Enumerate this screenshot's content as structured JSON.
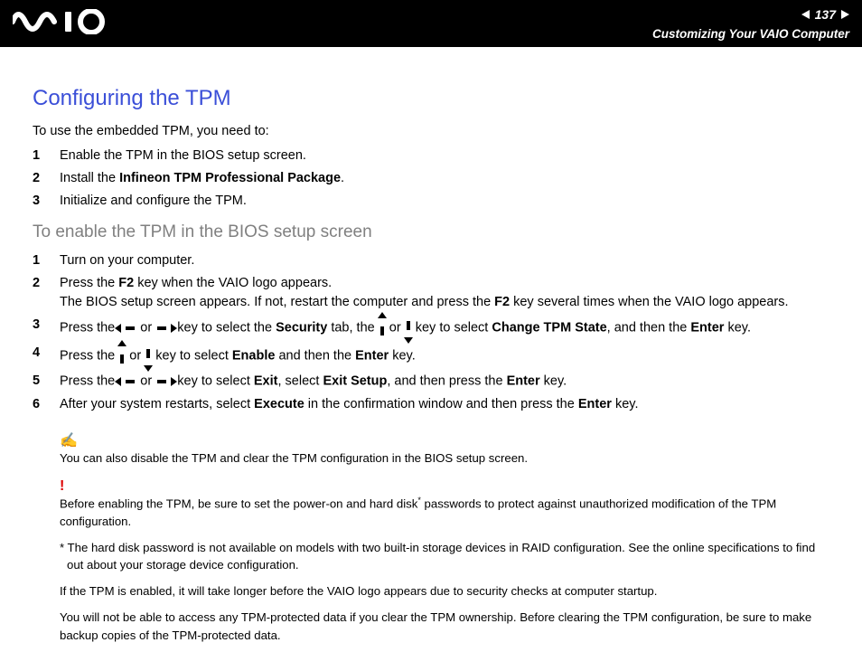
{
  "header": {
    "page_number": "137",
    "section": "Customizing Your VAIO Computer"
  },
  "title": "Configuring the TPM",
  "intro": "To use the embedded TPM, you need to:",
  "list1": {
    "i1": "Enable the TPM in the BIOS setup screen.",
    "i2_a": "Install the ",
    "i2_b": "Infineon TPM Professional Package",
    "i2_c": ".",
    "i3": "Initialize and configure the TPM."
  },
  "subtitle": "To enable the TPM in the BIOS setup screen",
  "list2": {
    "i1": "Turn on your computer.",
    "i2_a": "Press the ",
    "i2_b": "F2",
    "i2_c": " key when the VAIO logo appears.",
    "i2_line2_a": "The BIOS setup screen appears. If not, restart the computer and press the ",
    "i2_line2_b": "F2",
    "i2_line2_c": " key several times when the VAIO logo appears.",
    "i3_a": "Press the ",
    "i3_b": " or ",
    "i3_c": " key to select the ",
    "i3_d": "Security",
    "i3_e": " tab, the ",
    "i3_f": " or ",
    "i3_g": " key to select ",
    "i3_h": "Change TPM State",
    "i3_i": ", and then the ",
    "i3_j": "Enter",
    "i3_k": " key.",
    "i4_a": "Press the ",
    "i4_b": " or ",
    "i4_c": " key to select ",
    "i4_d": "Enable",
    "i4_e": " and then the ",
    "i4_f": "Enter",
    "i4_g": " key.",
    "i5_a": "Press the ",
    "i5_b": " or ",
    "i5_c": " key to select ",
    "i5_d": "Exit",
    "i5_e": ", select ",
    "i5_f": "Exit Setup",
    "i5_g": ", and then press the ",
    "i5_h": "Enter",
    "i5_i": " key.",
    "i6_a": "After your system restarts, select ",
    "i6_b": "Execute",
    "i6_c": " in the confirmation window and then press the ",
    "i6_d": "Enter",
    "i6_e": " key."
  },
  "notes": {
    "n1": "You can also disable the TPM and clear the TPM configuration in the BIOS setup screen.",
    "n2_a": "Before enabling the TPM, be sure to set the power-on and hard disk",
    "n2_b": " passwords to protect against unauthorized modification of the TPM configuration.",
    "n3": "* The hard disk password is not available on models with two built-in storage devices in RAID configuration. See the online specifications to find out about your storage device configuration.",
    "n4": "If the TPM is enabled, it will take longer before the VAIO logo appears due to security checks at computer startup.",
    "n5": "You will not be able to access any TPM-protected data if you clear the TPM ownership. Before clearing the TPM configuration, be sure to make backup copies of the TPM-protected data."
  },
  "nums": {
    "n1": "1",
    "n2": "2",
    "n3": "3",
    "n4": "4",
    "n5": "5",
    "n6": "6"
  }
}
